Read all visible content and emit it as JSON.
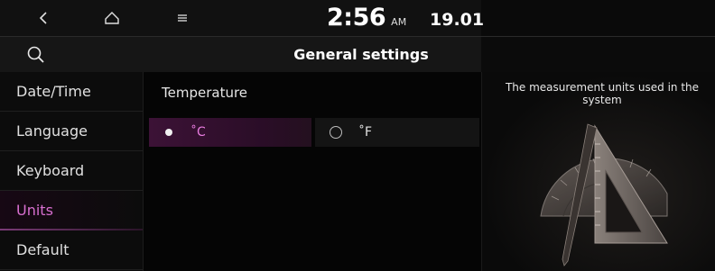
{
  "status_bar": {
    "time": "2:56",
    "ampm": "AM",
    "date": "19.01"
  },
  "header": {
    "title": "General settings"
  },
  "sidebar": {
    "items": [
      {
        "label": "Date/Time"
      },
      {
        "label": "Language"
      },
      {
        "label": "Keyboard"
      },
      {
        "label": "Units"
      },
      {
        "label": "Default"
      }
    ],
    "active": "Units"
  },
  "main": {
    "section_label": "Temperature",
    "options": [
      {
        "label": "˚C",
        "selected": true
      },
      {
        "label": "˚F",
        "selected": false
      }
    ]
  },
  "info_panel": {
    "text": "The measurement units used in the system"
  },
  "colors": {
    "accent": "#d86fd0",
    "selected_bg": "#3c1236"
  },
  "icons": [
    "back-icon",
    "home-icon",
    "menu-icon",
    "search-icon",
    "ruler-protractor-illustration"
  ]
}
